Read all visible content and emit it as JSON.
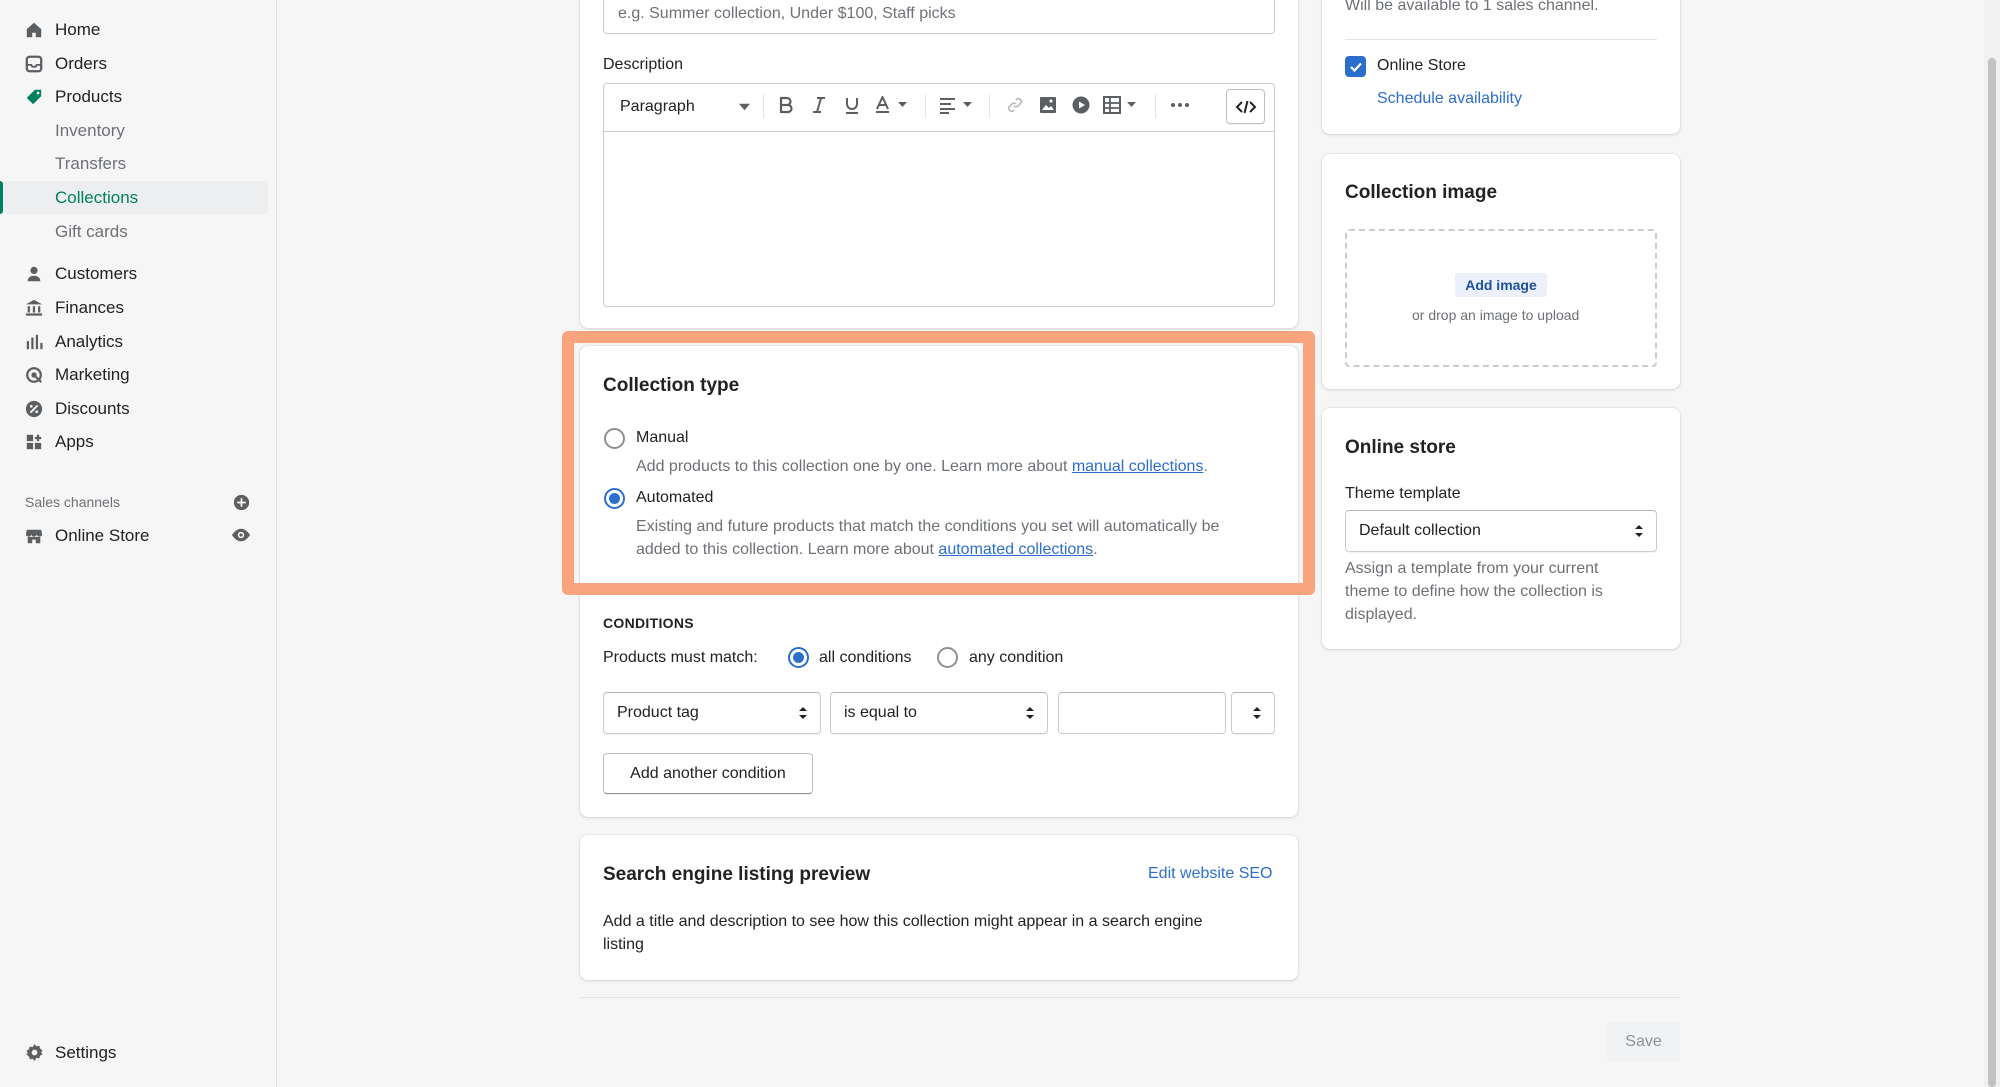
{
  "sidebar": {
    "items": [
      {
        "label": "Home"
      },
      {
        "label": "Orders"
      },
      {
        "label": "Products"
      },
      {
        "label": "Inventory"
      },
      {
        "label": "Transfers"
      },
      {
        "label": "Collections"
      },
      {
        "label": "Gift cards"
      },
      {
        "label": "Customers"
      },
      {
        "label": "Finances"
      },
      {
        "label": "Analytics"
      },
      {
        "label": "Marketing"
      },
      {
        "label": "Discounts"
      },
      {
        "label": "Apps"
      }
    ],
    "sales_channels_label": "Sales channels",
    "online_store_label": "Online Store",
    "settings_label": "Settings"
  },
  "title_input": {
    "placeholder": "e.g. Summer collection, Under $100, Staff picks"
  },
  "description": {
    "label": "Description",
    "format_select": "Paragraph"
  },
  "collection_type": {
    "title": "Collection type",
    "manual_label": "Manual",
    "manual_help_prefix": "Add products to this collection one by one. Learn more about ",
    "manual_link": "manual collections",
    "period": ".",
    "automated_label": "Automated",
    "automated_help_line1": "Existing and future products that match the conditions you set will automatically be",
    "automated_help_prefix": "added to this collection. Learn more about ",
    "automated_link": "automated collections"
  },
  "conditions": {
    "heading": "CONDITIONS",
    "match_label": "Products must match:",
    "all_label": "all conditions",
    "any_label": "any condition",
    "field_select": "Product tag",
    "operator_select": "is equal to",
    "value": "",
    "add_button": "Add another condition"
  },
  "seo": {
    "title": "Search engine listing preview",
    "edit_link": "Edit website SEO",
    "help_line1": "Add a title and description to see how this collection might appear in a search engine",
    "help_line2": "listing"
  },
  "availability": {
    "note": "Will be available to 1 sales channel.",
    "online_store_label": "Online Store",
    "schedule_link": "Schedule availability"
  },
  "collection_image": {
    "title": "Collection image",
    "add_button": "Add image",
    "drop_hint": "or drop an image to upload"
  },
  "online_store_card": {
    "title": "Online store",
    "theme_label": "Theme template",
    "theme_select": "Default collection",
    "help_line1": "Assign a template from your current",
    "help_line2": "theme to define how the collection is",
    "help_line3": "displayed."
  },
  "footer": {
    "save_label": "Save"
  },
  "colors": {
    "accent": "#2c6ecb",
    "brand": "#008060",
    "highlight": "#f9a47c"
  }
}
